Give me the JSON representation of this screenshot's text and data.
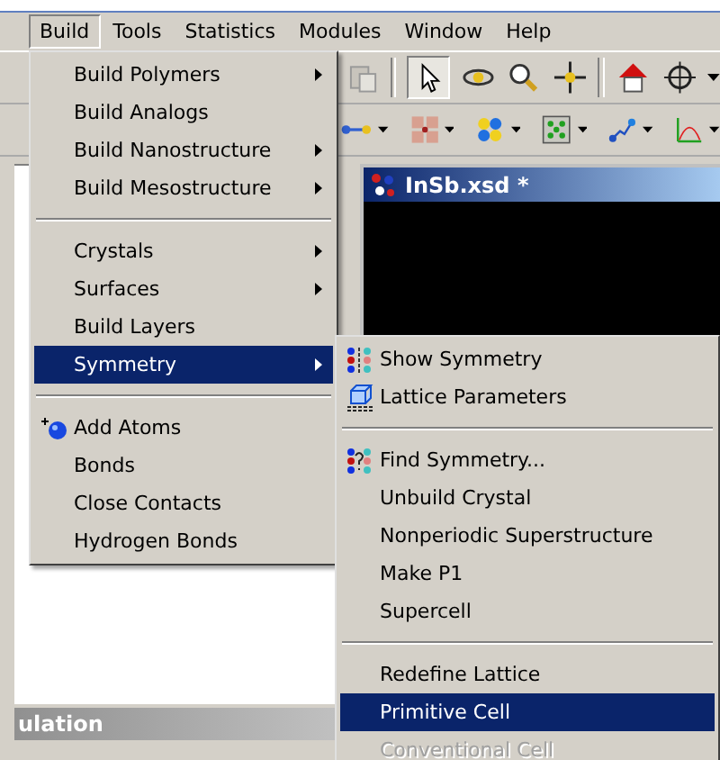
{
  "menubar": [
    {
      "label": "Build",
      "selected": true
    },
    {
      "label": "Tools",
      "selected": false
    },
    {
      "label": "Statistics",
      "selected": false
    },
    {
      "label": "Modules",
      "selected": false
    },
    {
      "label": "Window",
      "selected": false
    },
    {
      "label": "Help",
      "selected": false
    }
  ],
  "document_window": {
    "title": "InSb.xsd *"
  },
  "side_panel": {
    "title": "ulation"
  },
  "build_menu": {
    "groups": [
      [
        {
          "label": "Build Polymers",
          "kind": "plain",
          "submenu": true,
          "selected": false,
          "disabled": false
        },
        {
          "label": "Build Analogs",
          "kind": "plain",
          "submenu": false,
          "selected": false,
          "disabled": false
        },
        {
          "label": "Build Nanostructure",
          "kind": "plain",
          "submenu": true,
          "selected": false,
          "disabled": false
        },
        {
          "label": "Build Mesostructure",
          "kind": "plain",
          "submenu": true,
          "selected": false,
          "disabled": false
        }
      ],
      [
        {
          "label": "Crystals",
          "kind": "plain",
          "submenu": true,
          "selected": false,
          "disabled": false
        },
        {
          "label": "Surfaces",
          "kind": "plain",
          "submenu": true,
          "selected": false,
          "disabled": false
        },
        {
          "label": "Build Layers",
          "kind": "plain",
          "submenu": false,
          "selected": false,
          "disabled": false
        },
        {
          "label": "Symmetry",
          "kind": "plain",
          "submenu": true,
          "selected": true,
          "disabled": false
        }
      ],
      [
        {
          "label": "Add Atoms",
          "kind": "add-atom",
          "submenu": false,
          "selected": false,
          "disabled": false
        },
        {
          "label": "Bonds",
          "kind": "plain",
          "submenu": false,
          "selected": false,
          "disabled": false
        },
        {
          "label": "Close Contacts",
          "kind": "plain",
          "submenu": false,
          "selected": false,
          "disabled": false
        },
        {
          "label": "Hydrogen Bonds",
          "kind": "plain",
          "submenu": false,
          "selected": false,
          "disabled": false
        }
      ]
    ]
  },
  "symmetry_submenu": {
    "groups": [
      [
        {
          "label": "Show Symmetry",
          "kind": "symmetry",
          "submenu": false,
          "selected": false,
          "disabled": false
        },
        {
          "label": "Lattice Parameters",
          "kind": "lattice",
          "submenu": false,
          "selected": false,
          "disabled": false
        }
      ],
      [
        {
          "label": "Find Symmetry...",
          "kind": "find-symmetry",
          "submenu": false,
          "selected": false,
          "disabled": false
        },
        {
          "label": "Unbuild Crystal",
          "kind": "plain",
          "submenu": false,
          "selected": false,
          "disabled": false
        },
        {
          "label": "Nonperiodic Superstructure",
          "kind": "plain",
          "submenu": false,
          "selected": false,
          "disabled": false
        },
        {
          "label": "Make P1",
          "kind": "plain",
          "submenu": false,
          "selected": false,
          "disabled": false
        },
        {
          "label": "Supercell",
          "kind": "plain",
          "submenu": false,
          "selected": false,
          "disabled": false
        }
      ],
      [
        {
          "label": "Redefine Lattice",
          "kind": "plain",
          "submenu": false,
          "selected": false,
          "disabled": false
        },
        {
          "label": "Primitive Cell",
          "kind": "plain",
          "submenu": false,
          "selected": true,
          "disabled": false
        },
        {
          "label": "Conventional Cell",
          "kind": "plain",
          "submenu": false,
          "selected": false,
          "disabled": true
        }
      ]
    ]
  }
}
